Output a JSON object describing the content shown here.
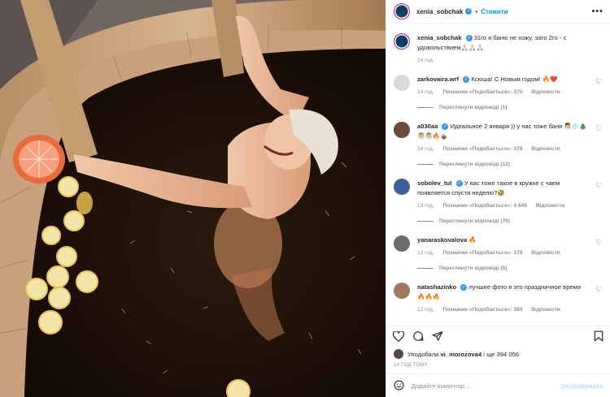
{
  "post": {
    "author": "xenia_sobchak",
    "follow_label": "Стежити",
    "more_label": "•••",
    "caption_text": "31го я баню не хожу, зато 2го - с удовольствием🙏🏻🙏🏻🙏🏻",
    "caption_time": "14 год."
  },
  "comments": [
    {
      "user": "zarkovaira.wrf",
      "verified": true,
      "text": "Ксюша! С Новым годом! 🔥❤️",
      "time": "14 год.",
      "likes": "Позначки «Подобається»: 375",
      "reply": "Відповісти",
      "view_replies": "Переглянути відповіді (1)",
      "avatar_color": "#d9d9d9"
    },
    {
      "user": "a030aa",
      "verified": true,
      "text": "Идеальное 2 января )) у нас тоже баня 🧖‍♀️❄️🎄🧖🏼‍♀️🧖🏼‍♀️🔥🧉",
      "time": "14 год.",
      "likes": "Позначки «Подобається»: 378",
      "reply": "Відповісти",
      "view_replies": "Переглянути відповіді (12)",
      "avatar_color": "#6b4a3a"
    },
    {
      "user": "sobolev_tut",
      "verified": true,
      "text": "У вас тоже такое в кружке с чаем появляется спустя неделю?🤣",
      "time": "13 год.",
      "likes": "Позначки «Подобається»: 4 645",
      "reply": "Відповісти",
      "view_replies": "Переглянути відповіді (70)",
      "avatar_color": "#3f5f9a"
    },
    {
      "user": "yanaraskovalova",
      "verified": false,
      "text": "🔥",
      "time": "13 год.",
      "likes": "Позначки «Подобається»: 178",
      "reply": "Відповісти",
      "view_replies": "Переглянути відповіді (5)",
      "avatar_color": "#6d6d6d"
    },
    {
      "user": "natashazinko",
      "verified": true,
      "text": "лучшее фото в это праздничное время 🔥🔥🔥",
      "time": "12 год.",
      "likes": "Позначки «Подобається»: 384",
      "reply": "Відповісти",
      "view_replies": "",
      "avatar_color": "#a07860"
    }
  ],
  "footer": {
    "liked_prefix": "Уподобали",
    "liked_user": "vi_morozova4",
    "liked_suffix": "і ще 394 056",
    "time_ago": "14 ГОД ТОМУ",
    "comment_placeholder": "Додайте коментар...",
    "publish_label": "Опублікувати"
  },
  "colors": {
    "accent": "#0095f6",
    "verified": "#3897f0",
    "muted": "#8e8e8e",
    "water": "#1b0f08",
    "wood": "#c9a27a"
  }
}
